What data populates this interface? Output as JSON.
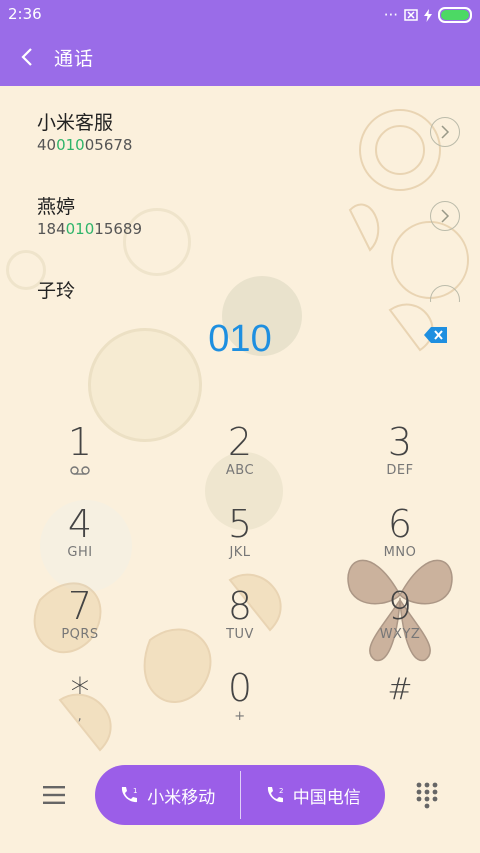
{
  "status_bar": {
    "time": "2:36",
    "icons": [
      "dots-icon",
      "sim-off-icon",
      "charging-icon",
      "battery-icon"
    ]
  },
  "header": {
    "title": "通话"
  },
  "contacts": [
    {
      "name": "小米客服",
      "number_prefix": "40",
      "number_match": "010",
      "number_suffix": "05678"
    },
    {
      "name": "燕婷",
      "number_prefix": "184",
      "number_match": "010",
      "number_suffix": "15689"
    },
    {
      "name": "子玲"
    }
  ],
  "dialer": {
    "entered_number": "010"
  },
  "keypad": [
    {
      "digit": "1",
      "letters": ""
    },
    {
      "digit": "2",
      "letters": "ABC"
    },
    {
      "digit": "3",
      "letters": "DEF"
    },
    {
      "digit": "4",
      "letters": "GHI"
    },
    {
      "digit": "5",
      "letters": "JKL"
    },
    {
      "digit": "6",
      "letters": "MNO"
    },
    {
      "digit": "7",
      "letters": "PQRS"
    },
    {
      "digit": "8",
      "letters": "TUV"
    },
    {
      "digit": "9",
      "letters": "WXYZ"
    },
    {
      "digit": "*",
      "letters": ","
    },
    {
      "digit": "0",
      "letters": "+"
    },
    {
      "digit": "#",
      "letters": ""
    }
  ],
  "bottom_bar": {
    "sim1": {
      "label": "小米移动",
      "slot": "1"
    },
    "sim2": {
      "label": "中国电信",
      "slot": "2"
    }
  },
  "colors": {
    "accent": "#9a6ce8",
    "match": "#2fb46a",
    "entered": "#1e8fe0",
    "background": "#fbf0dc"
  }
}
